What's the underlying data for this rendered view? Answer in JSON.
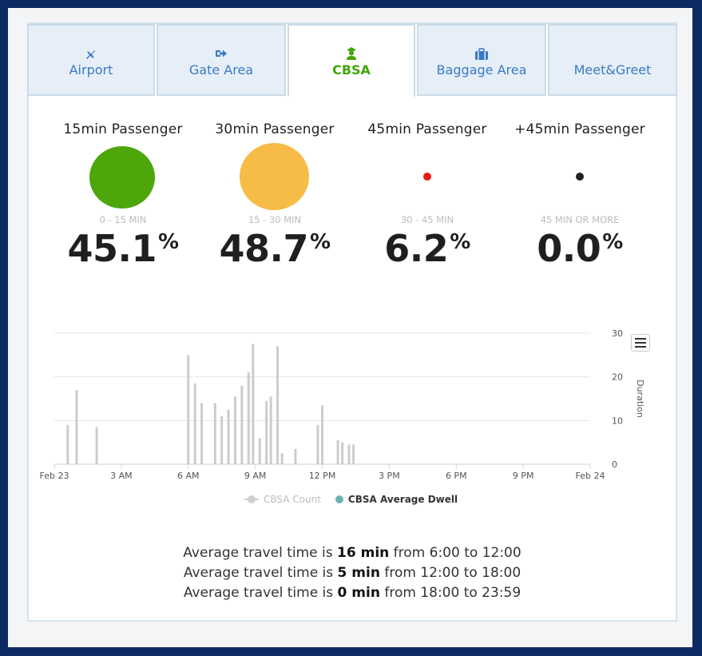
{
  "tabs": [
    {
      "label": "Airport",
      "icon": "plane-icon",
      "active": false
    },
    {
      "label": "Gate Area",
      "icon": "sign-out-icon",
      "active": false
    },
    {
      "label": "CBSA",
      "icon": "officer-icon",
      "active": true
    },
    {
      "label": "Baggage Area",
      "icon": "suitcase-icon",
      "active": false
    },
    {
      "label": "Meet&Greet",
      "icon": "",
      "active": false
    }
  ],
  "metrics": [
    {
      "title": "15min Passenger",
      "range": "0 - 15 MIN",
      "value": "45.1",
      "unit": "%",
      "color": "#4da60a"
    },
    {
      "title": "30min Passenger",
      "range": "15 - 30 MIN",
      "value": "48.7",
      "unit": "%",
      "color": "#f6bc47"
    },
    {
      "title": "45min Passenger",
      "range": "30 - 45 MIN",
      "value": "6.2",
      "unit": "%",
      "color": "#e61919"
    },
    {
      "title": "+45min Passenger",
      "range": "45 MIN OR MORE",
      "value": "0.0",
      "unit": "%",
      "color": "#222222"
    }
  ],
  "chart_data": {
    "type": "bar",
    "x_ticks": [
      "Feb 23",
      "3 AM",
      "6 AM",
      "9 AM",
      "12 PM",
      "3 PM",
      "6 PM",
      "9 PM",
      "Feb 24"
    ],
    "ylabel": "Duration",
    "y_ticks": [
      0,
      10,
      20,
      30
    ],
    "ylim": [
      0,
      30
    ],
    "grid": true,
    "legend_position": "bottom-center",
    "series": [
      {
        "name": "CBSA Count",
        "color": "#cccccc",
        "x_hours": [
          0.6,
          1.0,
          1.9,
          6.0,
          6.3,
          6.6,
          7.2,
          7.5,
          7.8,
          8.1,
          8.4,
          8.7,
          8.9,
          9.2,
          9.5,
          9.7,
          10.0,
          10.2,
          10.8,
          10.9,
          11.8,
          12.0,
          12.7,
          12.9,
          13.2,
          13.4
        ],
        "values": [
          9,
          17,
          8.5,
          25,
          18.5,
          14,
          14,
          11,
          12.5,
          15.5,
          18,
          21,
          27.5,
          6,
          14.5,
          15.5,
          27,
          2.5,
          3.5,
          0,
          9,
          13.5,
          5.5,
          5,
          4.5,
          4.5
        ]
      },
      {
        "name": "CBSA Average Dwell",
        "color": "#6ab3b5",
        "values": []
      }
    ]
  },
  "chart_menu_icon": "hamburger-menu-icon",
  "summary": [
    {
      "pre": "Average travel time is ",
      "value": "16 min",
      "post": " from 6:00 to 12:00"
    },
    {
      "pre": "Average travel time is ",
      "value": "5 min",
      "post": " from 12:00 to 18:00"
    },
    {
      "pre": "Average travel time is ",
      "value": "0 min",
      "post": " from 18:00 to 23:59"
    }
  ]
}
